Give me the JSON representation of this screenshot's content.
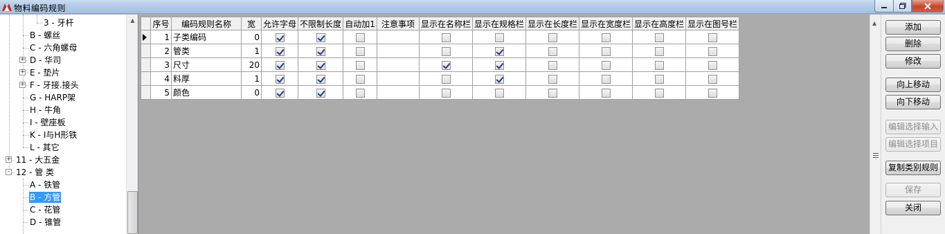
{
  "window": {
    "title": "物料编码规则"
  },
  "tree": {
    "items": [
      {
        "label": "3 - 牙杆",
        "level": 3,
        "expander": "",
        "selected": false
      },
      {
        "label": "B - 螺丝",
        "level": 2,
        "expander": "",
        "selected": false
      },
      {
        "label": "C - 六角螺母",
        "level": 2,
        "expander": "",
        "selected": false
      },
      {
        "label": "D - 华司",
        "level": 2,
        "expander": "+",
        "selected": false
      },
      {
        "label": "E - 垫片",
        "level": 2,
        "expander": "+",
        "selected": false
      },
      {
        "label": "F - 牙接.接头",
        "level": 2,
        "expander": "+",
        "selected": false
      },
      {
        "label": "G - HARP架",
        "level": 2,
        "expander": "",
        "selected": false
      },
      {
        "label": "H - 牛角",
        "level": 2,
        "expander": "",
        "selected": false
      },
      {
        "label": "I - 壁座板",
        "level": 2,
        "expander": "",
        "selected": false
      },
      {
        "label": "K - I与H形铁",
        "level": 2,
        "expander": "",
        "selected": false
      },
      {
        "label": "L - 其它",
        "level": 2,
        "expander": "",
        "selected": false
      },
      {
        "label": "11 - 大五金",
        "level": 1,
        "expander": "+",
        "selected": false
      },
      {
        "label": "12 - 管  类",
        "level": 1,
        "expander": "-",
        "selected": false
      },
      {
        "label": "A - 铁管",
        "level": 2,
        "expander": "",
        "selected": false
      },
      {
        "label": "B - 方管",
        "level": 2,
        "expander": "",
        "selected": true
      },
      {
        "label": "C - 花管",
        "level": 2,
        "expander": "",
        "selected": false
      },
      {
        "label": "D - 锥管",
        "level": 2,
        "expander": "",
        "selected": false
      }
    ]
  },
  "grid": {
    "columns": [
      "序号",
      "编码规则名称",
      "宽",
      "允许字母",
      "不限制长度",
      "自动加1",
      "注意事项",
      "显示在名称栏",
      "显示在规格栏",
      "显示在长度栏",
      "显示在宽度栏",
      "显示在高度栏",
      "显示在图号栏"
    ],
    "rows": [
      {
        "seq": "1",
        "name": "子类编码",
        "width": "0",
        "checks": [
          true,
          true,
          false,
          null,
          false,
          false,
          false,
          false,
          false,
          false
        ],
        "current": true
      },
      {
        "seq": "2",
        "name": "管类",
        "width": "1",
        "checks": [
          true,
          true,
          false,
          null,
          false,
          true,
          false,
          false,
          false,
          false
        ],
        "current": false
      },
      {
        "seq": "3",
        "name": "尺寸",
        "width": "20",
        "checks": [
          true,
          true,
          false,
          null,
          true,
          true,
          false,
          false,
          false,
          false
        ],
        "current": false
      },
      {
        "seq": "4",
        "name": "料厚",
        "width": "1",
        "checks": [
          true,
          true,
          false,
          null,
          false,
          true,
          false,
          false,
          false,
          false
        ],
        "current": false
      },
      {
        "seq": "5",
        "name": "颜色",
        "width": "0",
        "checks": [
          true,
          true,
          false,
          null,
          false,
          false,
          false,
          false,
          false,
          false
        ],
        "current": false
      }
    ]
  },
  "buttons": [
    {
      "label": "添加",
      "name": "add-button",
      "enabled": true
    },
    {
      "label": "删除",
      "name": "delete-button",
      "enabled": true
    },
    {
      "label": "修改",
      "name": "edit-button",
      "enabled": true
    },
    {
      "label": "向上移动",
      "name": "move-up-button",
      "enabled": true
    },
    {
      "label": "向下移动",
      "name": "move-down-button",
      "enabled": true
    },
    {
      "label": "编辑选择输入",
      "name": "edit-select-input-button",
      "enabled": false
    },
    {
      "label": "编辑选择项目",
      "name": "edit-select-items-button",
      "enabled": false
    },
    {
      "label": "复制类别规则",
      "name": "copy-category-rule-button",
      "enabled": true
    },
    {
      "label": "保存",
      "name": "save-button",
      "enabled": false
    },
    {
      "label": "关闭",
      "name": "close-button",
      "enabled": true
    }
  ],
  "icons": {
    "app": "app-logo-icon",
    "minimize": "minimize-icon",
    "maximize": "maximize-icon",
    "close": "close-icon"
  }
}
